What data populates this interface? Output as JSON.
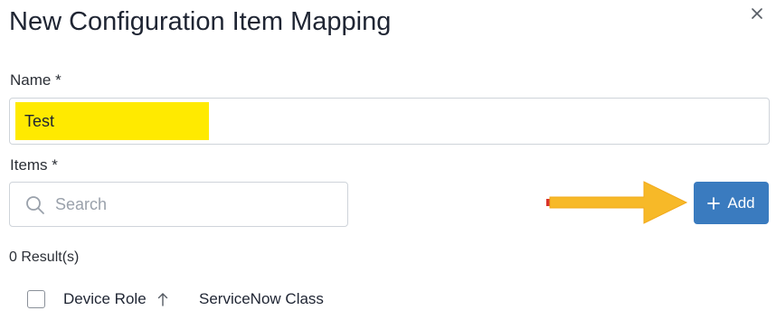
{
  "dialog": {
    "title": "New Configuration Item Mapping",
    "close_icon": "close-icon"
  },
  "form": {
    "name_label": "Name *",
    "name_value": "Test",
    "items_label": "Items *",
    "search_placeholder": "Search",
    "search_value": "",
    "add_label": "Add",
    "highlight_color": "#ffea00",
    "arrow_color": "#f7b928",
    "accent_color": "#3a7bbf"
  },
  "results": {
    "count_text": "0 Result(s)"
  },
  "table": {
    "columns": [
      {
        "label": "Device Role",
        "sort": "ascending"
      },
      {
        "label": "ServiceNow Class"
      }
    ]
  }
}
